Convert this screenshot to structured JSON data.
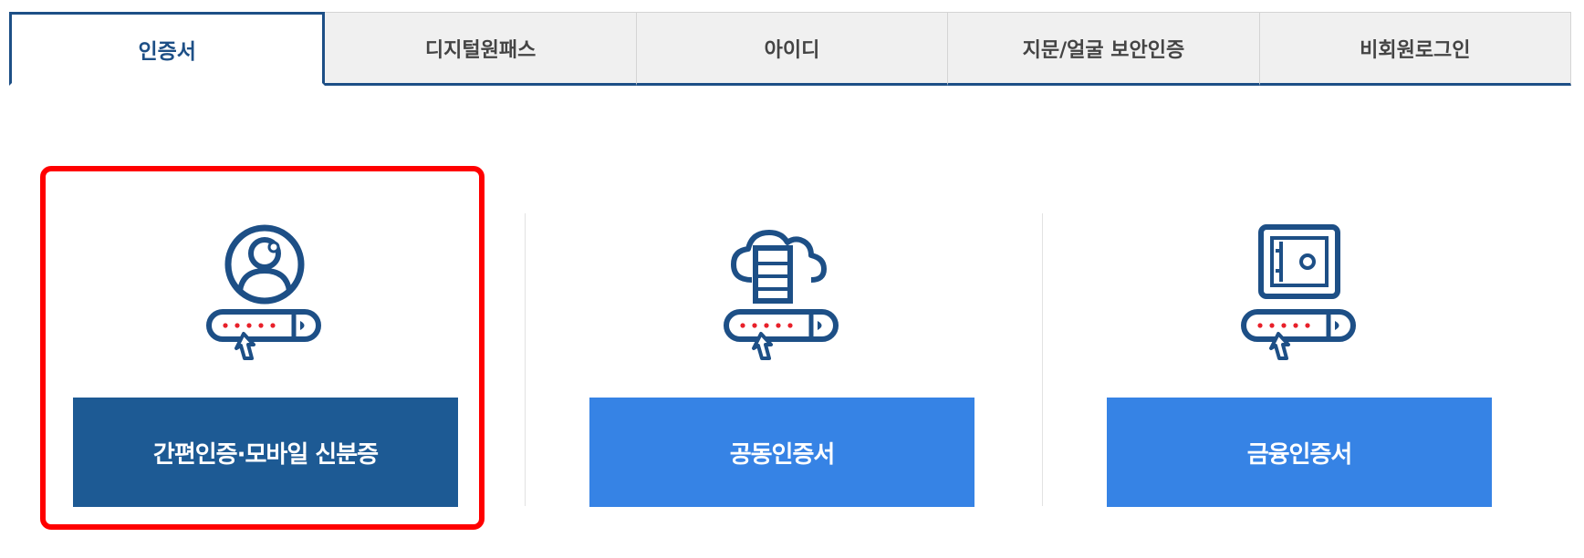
{
  "tabs": [
    {
      "label": "인증서",
      "active": true
    },
    {
      "label": "디지털원패스",
      "active": false
    },
    {
      "label": "아이디",
      "active": false
    },
    {
      "label": "지문/얼굴 보안인증",
      "active": false
    },
    {
      "label": "비회원로그인",
      "active": false
    }
  ],
  "methods": [
    {
      "label": "간편인증·모바일 신분증",
      "icon": "user-password-icon",
      "selected": true
    },
    {
      "label": "공동인증서",
      "icon": "cloud-server-password-icon",
      "selected": false
    },
    {
      "label": "금융인증서",
      "icon": "safe-password-icon",
      "selected": false
    }
  ],
  "colors": {
    "navy": "#1d4f86",
    "primary_dark": "#1d5a94",
    "primary_light": "#3683e5",
    "selection": "#ff0000",
    "password_dot": "#e8202a"
  }
}
